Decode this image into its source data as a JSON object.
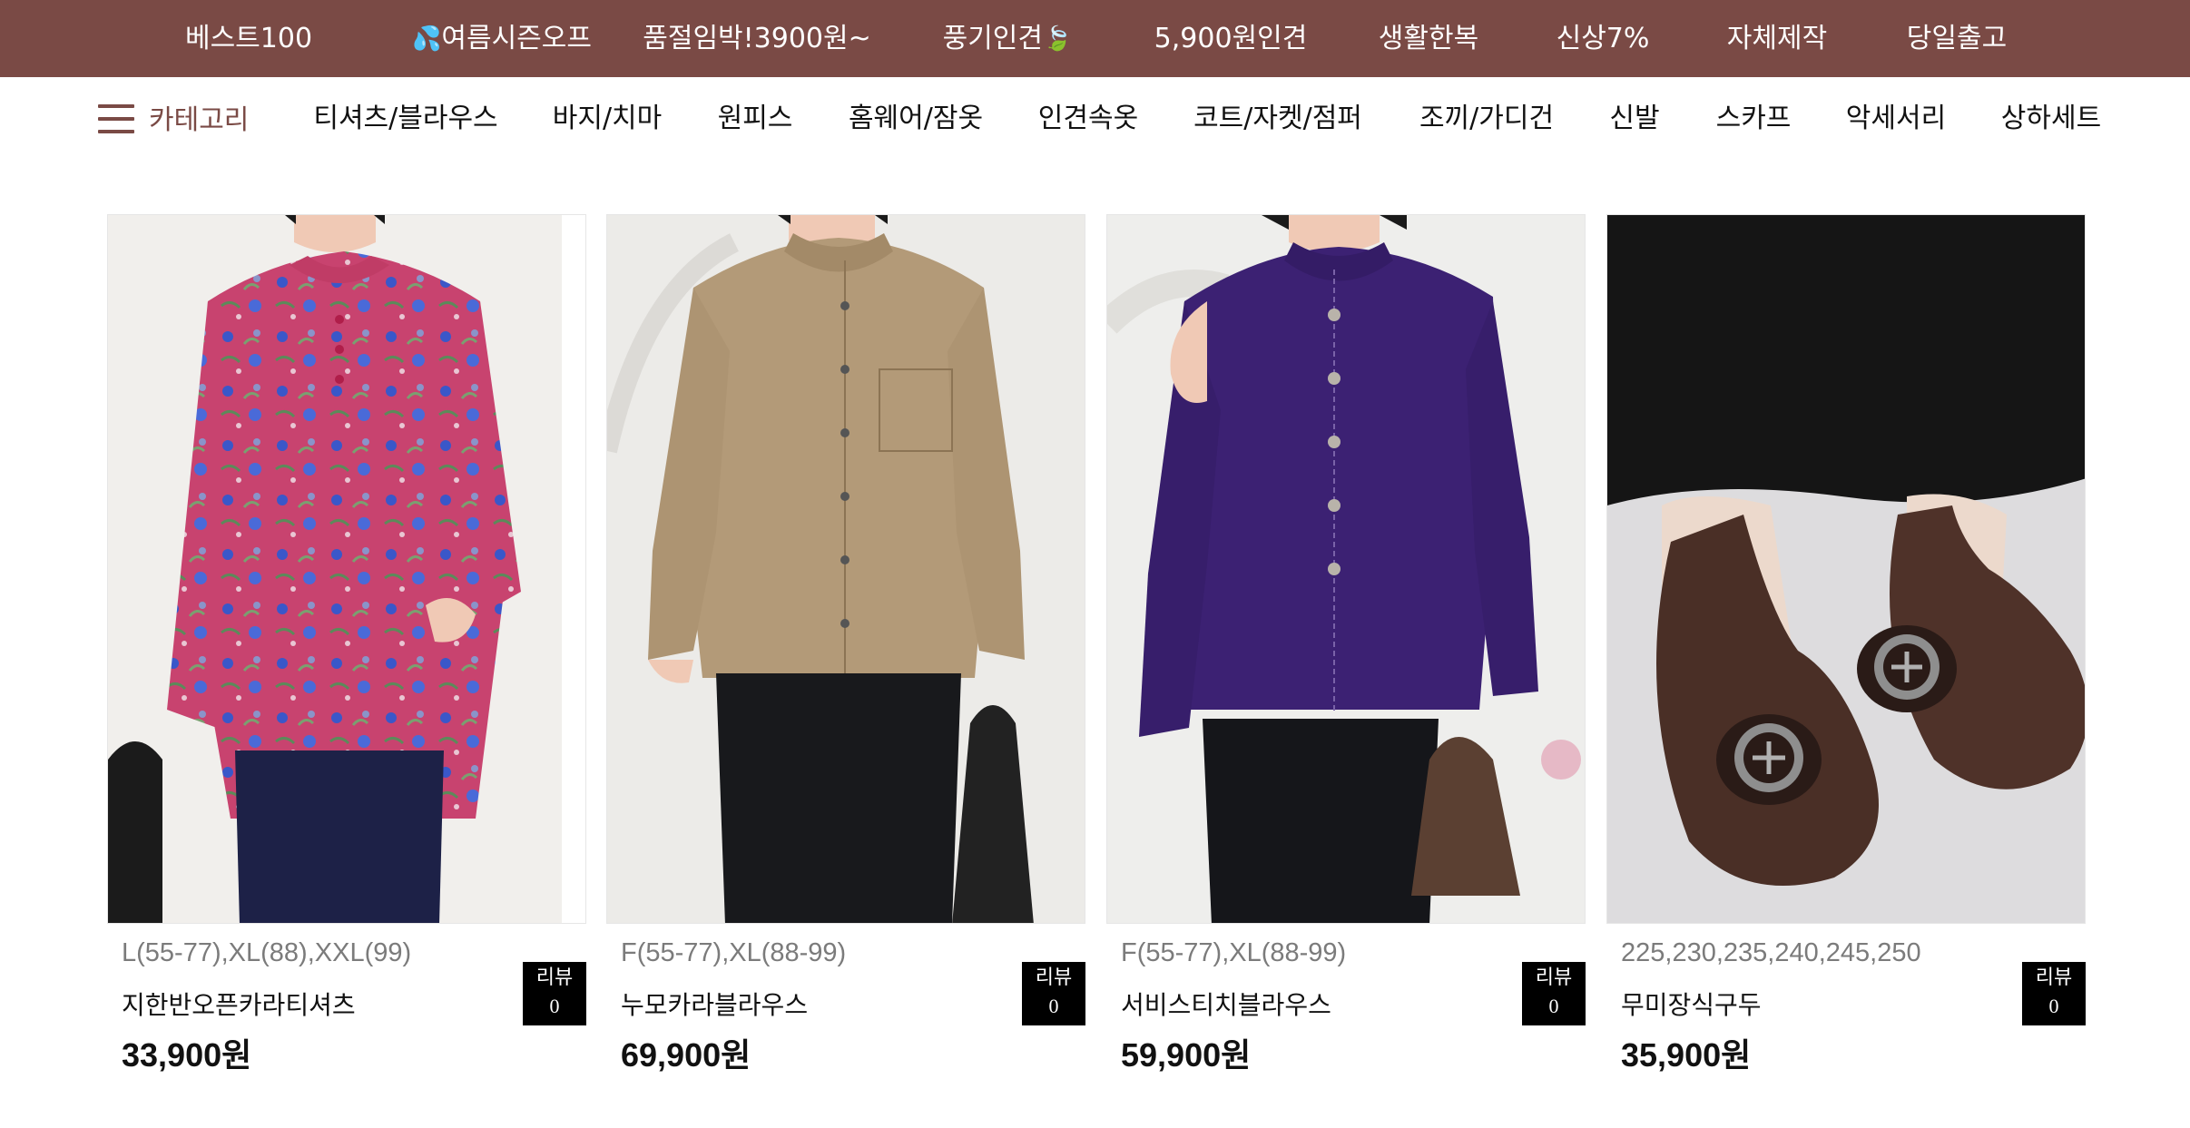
{
  "topnav": [
    {
      "label": "베스트100",
      "emoji": ""
    },
    {
      "label": "여름시즌오프",
      "emoji": "💦",
      "emoji_pos": "before"
    },
    {
      "label": "품절임박!3900원~",
      "emoji": ""
    },
    {
      "label": "풍기인견",
      "emoji": "🍃",
      "emoji_pos": "after"
    },
    {
      "label": "5,900원인견",
      "emoji": ""
    },
    {
      "label": "생활한복",
      "emoji": ""
    },
    {
      "label": "신상7%",
      "emoji": ""
    },
    {
      "label": "자체제작",
      "emoji": ""
    },
    {
      "label": "당일출고",
      "emoji": ""
    }
  ],
  "category_menu": {
    "label": "카테고리",
    "icon": "hamburger-menu-icon"
  },
  "categories": [
    "티셔츠/블라우스",
    "바지/치마",
    "원피스",
    "홈웨어/잠옷",
    "인견속옷",
    "코트/자켓/점퍼",
    "조끼/가디건",
    "신발",
    "스카프",
    "악세서리",
    "상하세트"
  ],
  "products": [
    {
      "sizes": "L(55-77),XL(88),XXL(99)",
      "name": "지한반오픈카라티셔츠",
      "price": "33,900원",
      "review_label": "리뷰",
      "review_count": "0",
      "image": "pink-floral-blouse"
    },
    {
      "sizes": "F(55-77),XL(88-99)",
      "name": "누모카라블라우스",
      "price": "69,900원",
      "review_label": "리뷰",
      "review_count": "0",
      "image": "beige-shirt-blouse"
    },
    {
      "sizes": "F(55-77),XL(88-99)",
      "name": "서비스티치블라우스",
      "price": "59,900원",
      "review_label": "리뷰",
      "review_count": "0",
      "image": "purple-stitch-blouse"
    },
    {
      "sizes": "225,230,235,240,245,250",
      "name": "무미장식구두",
      "price": "35,900원",
      "review_label": "리뷰",
      "review_count": "0",
      "image": "brown-flat-shoes"
    }
  ],
  "colors": {
    "brand": "#7a4a45",
    "text": "#111111",
    "muted": "#7b7b7b",
    "badge": "#000000"
  }
}
